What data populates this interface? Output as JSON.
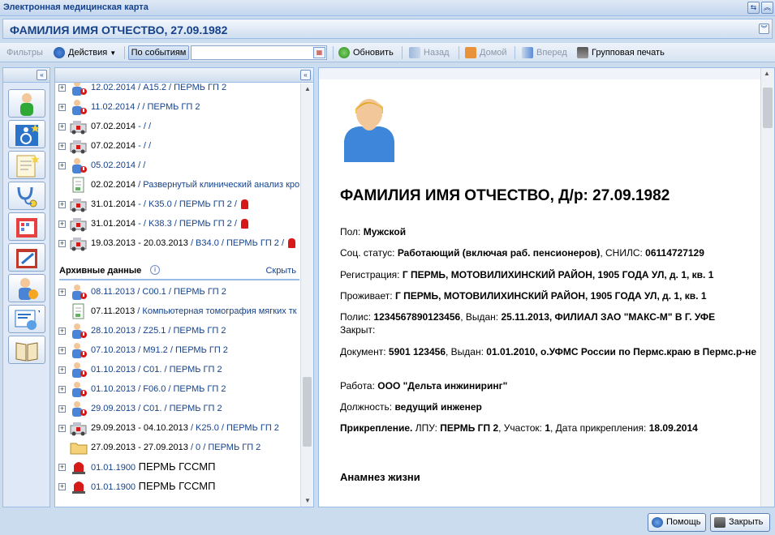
{
  "window": {
    "title": "Электронная медицинская карта",
    "btn_refresh_icon": "refresh-icon",
    "btn_collapse_icon": "chevron-up-icon"
  },
  "patient_header": {
    "name": "ФАМИЛИЯ ИМЯ ОТЧЕСТВО, 27.09.1982"
  },
  "toolbar": {
    "filters_label": "Фильтры",
    "actions_label": "Действия",
    "by_events_label": "По событиям",
    "search_value": "",
    "refresh_label": "Обновить",
    "back_label": "Назад",
    "home_label": "Домой",
    "forward_label": "Вперед",
    "group_print_label": "Групповая печать"
  },
  "tree": {
    "rows": [
      {
        "date": "12.02.2014",
        "rest": " / А15.2 / ПЕРМЬ ГП 2",
        "icon": "doctor"
      },
      {
        "date": "11.02.2014",
        "rest": " /  / ПЕРМЬ ГП 2",
        "icon": "doctor"
      },
      {
        "date": "07.02.2014",
        "rest": " - / /",
        "icon": "ambulance"
      },
      {
        "date": "07.02.2014",
        "rest": " - / /",
        "icon": "ambulance"
      },
      {
        "date": "05.02.2014",
        "rest": " /  /",
        "icon": "doctor"
      },
      {
        "date": "02.02.2014",
        "rest": " / Развернутый клинический анализ кро",
        "icon": "doc"
      },
      {
        "date": "31.01.2014",
        "rest": " - / K35.0 / ПЕРМЬ ГП 2 /",
        "icon": "ambulance",
        "alarm": true
      },
      {
        "date": "31.01.2014",
        "rest": " - / K38.3 / ПЕРМЬ ГП 2 /",
        "icon": "ambulance",
        "alarm": true
      },
      {
        "date": "19.03.2013 - 20.03.2013",
        "rest": " / B34.0 / ПЕРМЬ ГП 2 /",
        "icon": "ambulance",
        "alarm": true
      }
    ],
    "archive_title": "Архивные данные",
    "archive_hide": "Скрыть",
    "archive_rows": [
      {
        "date": "08.11.2013",
        "rest": " / C00.1 / ПЕРМЬ ГП 2",
        "icon": "doctor"
      },
      {
        "date": "07.11.2013",
        "rest": " / Компьютерная томография мягких тк",
        "icon": "doc"
      },
      {
        "date": "28.10.2013",
        "rest": " / Z25.1 / ПЕРМЬ ГП 2",
        "icon": "doctor"
      },
      {
        "date": "07.10.2013",
        "rest": " / M91.2 / ПЕРМЬ ГП 2",
        "icon": "doctor"
      },
      {
        "date": "01.10.2013",
        "rest": " / C01. / ПЕРМЬ ГП 2",
        "icon": "doctor"
      },
      {
        "date": "01.10.2013",
        "rest": " / F06.0 / ПЕРМЬ ГП 2",
        "icon": "doctor"
      },
      {
        "date": "29.09.2013",
        "rest": " / C01. / ПЕРМЬ ГП 2",
        "icon": "doctor"
      },
      {
        "date": "29.09.2013 - 04.10.2013",
        "rest": " / K25.0 / ПЕРМЬ ГП 2",
        "icon": "ambulance"
      },
      {
        "date": "27.09.2013 - 27.09.2013",
        "rest": " / 0 / ПЕРМЬ ГП 2",
        "icon": "folder"
      },
      {
        "date": "01.01.1900",
        "rest": " ПЕРМЬ ГССМП",
        "icon": "siren",
        "big": true
      },
      {
        "date": "01.01.1900",
        "rest": " ПЕРМЬ ГССМП",
        "icon": "siren",
        "big": true
      }
    ]
  },
  "detail": {
    "title": "ФАМИЛИЯ ИМЯ ОТЧЕСТВО, Д/р: 27.09.1982",
    "sex_label": "Пол:",
    "sex_value": "Мужской",
    "social_label": "Соц. статус:",
    "social_value": "Работающий (включая раб. пенсионеров)",
    "snils_label": ", СНИЛС:",
    "snils_value": "06114727129",
    "reg_label": "Регистрация:",
    "reg_value": "Г ПЕРМЬ, МОТОВИЛИХИНСКИЙ РАЙОН, 1905 ГОДА УЛ, д. 1, кв. 1",
    "live_label": "Проживает:",
    "live_value": "Г ПЕРМЬ, МОТОВИЛИХИНСКИЙ РАЙОН, 1905 ГОДА УЛ, д. 1, кв. 1",
    "policy_label": "Полис:",
    "policy_value": "1234567890123456",
    "policy_issued_label": ", Выдан:",
    "policy_issued_value": "25.11.2013, ФИЛИАЛ ЗАО \"МАКС-М\" В Г. УФЕ",
    "closed_label": "Закрыт:",
    "doc_label": "Документ:",
    "doc_value": "5901 123456",
    "doc_issued_label": ", Выдан:",
    "doc_issued_value": "01.01.2010, о.УФМС России по Пермс.краю в Пермс.р-не",
    "work_label": "Работа:",
    "work_value": "ООО \"Дельта инжиниринг\"",
    "position_label": "Должность:",
    "position_value": "ведущий инженер",
    "attach_label": "Прикрепление.",
    "attach_lpu_label": " ЛПУ:",
    "attach_lpu_value": "ПЕРМЬ ГП 2",
    "attach_area_label": ", Участок:",
    "attach_area_value": "1",
    "attach_date_label": ", Дата прикрепления:",
    "attach_date_value": "18.09.2014",
    "anamnesis_title": "Анамнез жизни"
  },
  "footer": {
    "help_label": "Помощь",
    "close_label": "Закрыть"
  },
  "colors": {
    "header_blue": "#15428b",
    "border": "#99bbe8",
    "alarm_red": "#d61a1a"
  }
}
